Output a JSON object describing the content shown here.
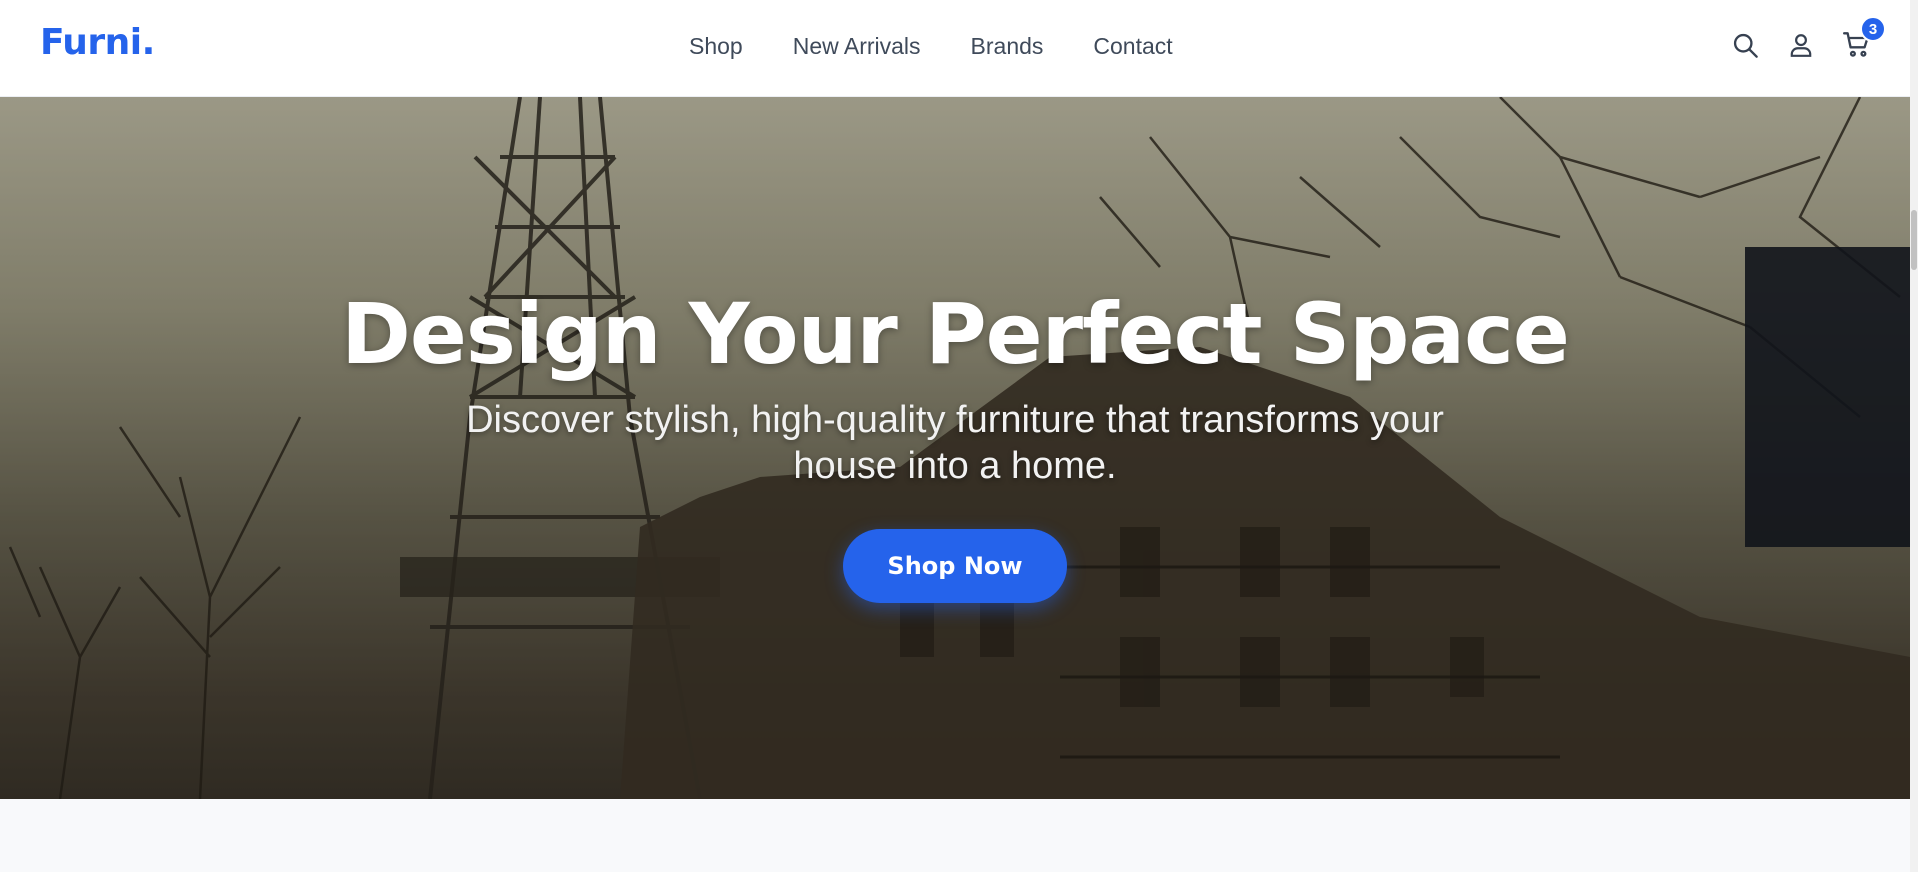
{
  "brand": {
    "logo": "Furni."
  },
  "nav": {
    "items": [
      "Shop",
      "New Arrivals",
      "Brands",
      "Contact"
    ]
  },
  "header_icons": {
    "search": "search-icon",
    "account": "user-icon",
    "cart": "cart-icon",
    "cart_count": "3"
  },
  "hero": {
    "title": "Design Your Perfect Space",
    "subtitle": "Discover stylish, high-quality furniture that transforms your house into a home.",
    "cta_label": "Shop Now"
  },
  "colors": {
    "accent": "#2563eb",
    "nav_text": "#3f4a5a",
    "header_bg": "#ffffff",
    "page_bg": "#f8f9fb"
  }
}
